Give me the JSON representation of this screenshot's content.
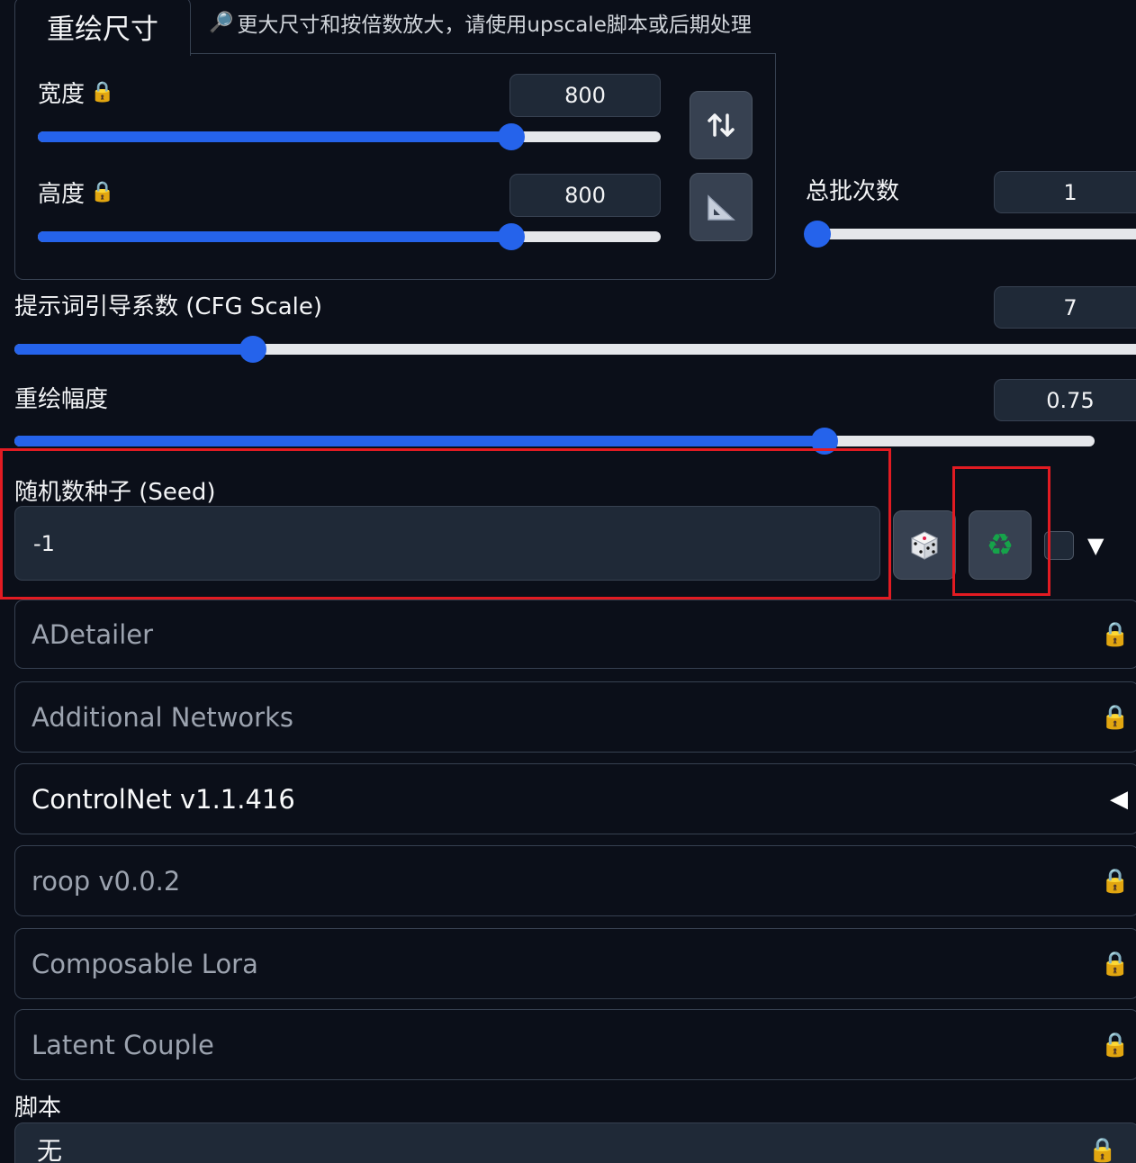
{
  "size_panel": {
    "tab_label": "重绘尺寸",
    "hint_icon": "magnifier-icon",
    "hint_text": "更大尺寸和按倍数放大，请使用upscale脚本或后期处理",
    "width": {
      "label": "宽度",
      "value": "800",
      "slider_fraction": 0.76
    },
    "height": {
      "label": "高度",
      "value": "800",
      "slider_fraction": 0.76
    },
    "swap_icon": "swap-vertical-arrows-icon",
    "ratio_icon": "triangle-ruler-icon"
  },
  "batch_count": {
    "label": "总批次数",
    "value": "1",
    "slider_fraction": 0.0
  },
  "cfg_scale": {
    "label": "提示词引导系数 (CFG Scale)",
    "value": "7",
    "slider_fraction": 0.21
  },
  "denoise": {
    "label": "重绘幅度",
    "value": "0.75",
    "slider_fraction": 0.75
  },
  "seed": {
    "label": "随机数种子 (Seed)",
    "value": "-1",
    "random_icon": "dice-icon",
    "reuse_icon": "recycle-icon",
    "extra_toggle_icon": "triangle-down-icon"
  },
  "accordions": [
    {
      "label": "ADetailer",
      "icon": "lock-icon",
      "open": false
    },
    {
      "label": "Additional Networks",
      "icon": "lock-icon",
      "open": false
    },
    {
      "label": "ControlNet v1.1.416",
      "icon": "triangle-left-icon",
      "open": true
    },
    {
      "label": "roop v0.0.2",
      "icon": "lock-icon",
      "open": false
    },
    {
      "label": "Composable Lora",
      "icon": "lock-icon",
      "open": false
    },
    {
      "label": "Latent Couple",
      "icon": "lock-icon",
      "open": false
    }
  ],
  "script": {
    "label": "脚本",
    "value": "无",
    "icon": "lock-icon"
  },
  "colors": {
    "accent": "#2563eb",
    "highlight": "#e21b22",
    "background": "#0b0f19"
  }
}
